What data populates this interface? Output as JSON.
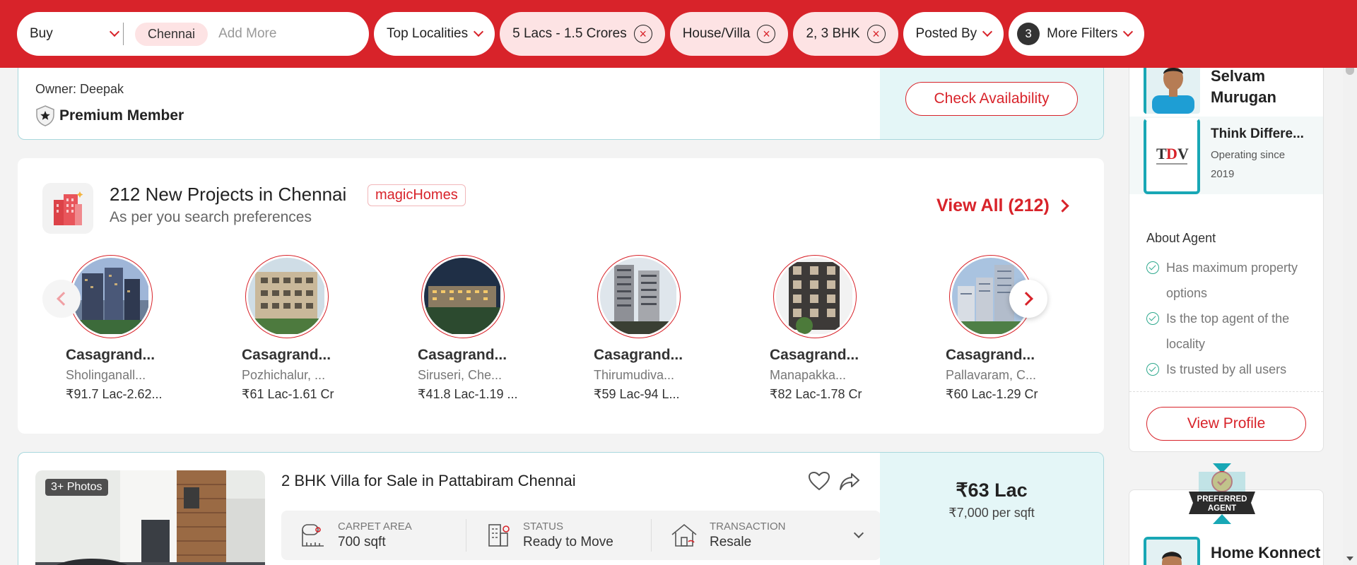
{
  "topbar": {
    "buy_label": "Buy",
    "city_chip": "Chennai",
    "add_more_placeholder": "Add More",
    "filters": {
      "top_localities": "Top Localities",
      "budget": "5 Lacs - 1.5 Crores",
      "type": "House/Villa",
      "bhk": "2, 3 BHK",
      "posted_by": "Posted By",
      "more_filters_count": "3",
      "more_filters": "More Filters"
    },
    "clear_glyph": "×",
    "colors": {
      "brand": "#d8232a"
    }
  },
  "listing_top": {
    "owner": "Owner: Deepak",
    "premium": "Premium Member",
    "check_availability": "Check Availability"
  },
  "projects": {
    "title": "212 New Projects in Chennai",
    "badge": "magicHomes",
    "subtitle": "As per you search preferences",
    "view_all": "View All (212)",
    "items": [
      {
        "name": "Casagrand...",
        "location": "Sholinganall...",
        "price": "₹91.7 Lac-2.62..."
      },
      {
        "name": "Casagrand...",
        "location": "Pozhichalur, ...",
        "price": "₹61 Lac-1.61 Cr"
      },
      {
        "name": "Casagrand...",
        "location": "Siruseri, Che...",
        "price": "₹41.8 Lac-1.19 ..."
      },
      {
        "name": "Casagrand...",
        "location": "Thirumudiva...",
        "price": "₹59 Lac-94 L..."
      },
      {
        "name": "Casagrand...",
        "location": "Manapakka...",
        "price": "₹82 Lac-1.78 Cr"
      },
      {
        "name": "Casagrand...",
        "location": "Pallavaram, C...",
        "price": "₹60 Lac-1.29 Cr"
      }
    ]
  },
  "listing_bottom": {
    "photos_badge": "3+ Photos",
    "title": "2 BHK Villa for Sale in Pattabiram Chennai",
    "specs": [
      {
        "label": "CARPET AREA",
        "value": "700 sqft",
        "icon": "ruler-icon"
      },
      {
        "label": "STATUS",
        "value": "Ready to Move",
        "icon": "building-icon"
      },
      {
        "label": "TRANSACTION",
        "value": "Resale",
        "icon": "house-icon"
      }
    ],
    "price": "₹63 Lac",
    "price_per_sqft": "₹7,000 per sqft"
  },
  "agent": {
    "name": "Selvam Murugan",
    "agency": "Think Differe...",
    "since": "Operating since 2019",
    "about_label": "About Agent",
    "bullets": [
      "Has maximum property options",
      "Is the top agent of the locality",
      "Is trusted by all users"
    ],
    "view_profile": "View Profile"
  },
  "agent2": {
    "badge_line1": "PREFERRED",
    "badge_line2": "AGENT",
    "name": "Home Konnect"
  }
}
